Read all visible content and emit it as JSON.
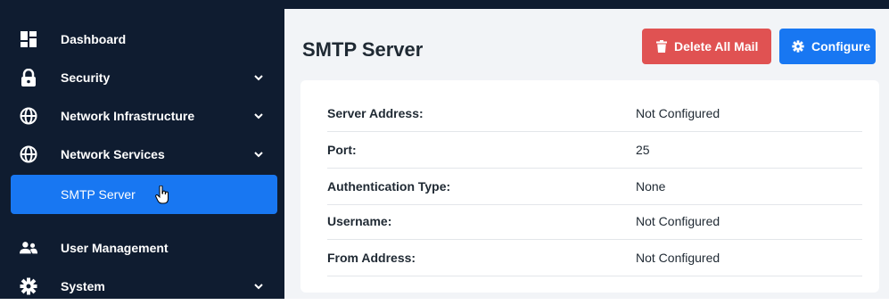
{
  "sidebar": {
    "items": [
      {
        "label": "Dashboard",
        "icon": "dashboard-icon"
      },
      {
        "label": "Security",
        "icon": "lock-icon"
      },
      {
        "label": "Network Infrastructure",
        "icon": "globe-icon"
      },
      {
        "label": "Network Services",
        "icon": "globe-icon"
      },
      {
        "label": "User Management",
        "icon": "users-icon"
      },
      {
        "label": "System",
        "icon": "gear-icon"
      }
    ],
    "subitem": {
      "label": "SMTP Server"
    }
  },
  "header": {
    "title": "SMTP Server",
    "delete_label": "Delete All Mail",
    "configure_label": "Configure"
  },
  "details": [
    {
      "key": "Server Address:",
      "value": "Not Configured"
    },
    {
      "key": "Port:",
      "value": "25"
    },
    {
      "key": "Authentication Type:",
      "value": "None"
    },
    {
      "key": "Username:",
      "value": "Not Configured"
    },
    {
      "key": "From Address:",
      "value": "Not Configured"
    }
  ],
  "colors": {
    "sidebar_bg": "#0f1c30",
    "accent": "#1877f2",
    "danger": "#e05252",
    "content_bg": "#f2f4f7"
  }
}
